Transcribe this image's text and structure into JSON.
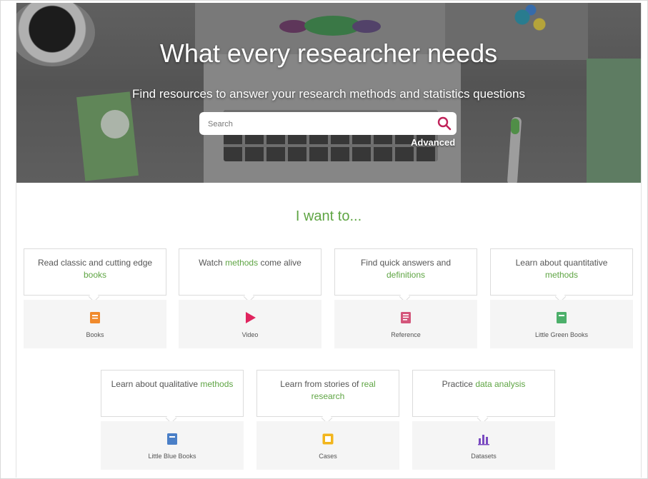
{
  "hero": {
    "title": "What every researcher needs",
    "subtitle": "Find resources to answer your research methods and statistics questions",
    "search_placeholder": "Search",
    "advanced_label": "Advanced"
  },
  "want_heading": "I want to...",
  "colors": {
    "accent_green": "#5fa544",
    "books_orange": "#f08a2c",
    "video_red": "#e0245e",
    "reference_pink": "#d3557a",
    "lgb_green": "#4caf6a",
    "lbb_blue": "#4a7fc7",
    "cases_yellow": "#f2b51c",
    "datasets_purple": "#7a4bc1"
  },
  "cards_row1": [
    {
      "pre": "Read classic and cutting edge ",
      "hl": "books",
      "post": "",
      "label": "Books",
      "icon": "book-icon"
    },
    {
      "pre": "Watch ",
      "hl": "methods",
      "post": " come alive",
      "label": "Video",
      "icon": "play-icon"
    },
    {
      "pre": "Find quick answers and ",
      "hl": "definitions",
      "post": "",
      "label": "Reference",
      "icon": "reference-icon"
    },
    {
      "pre": "Learn about quantitative ",
      "hl": "methods",
      "post": "",
      "label": "Little Green Books",
      "icon": "green-book-icon"
    }
  ],
  "cards_row2": [
    {
      "pre": "Learn about qualitative ",
      "hl": "methods",
      "post": "",
      "label": "Little Blue Books",
      "icon": "blue-book-icon"
    },
    {
      "pre": "Learn from stories of ",
      "hl": "real research",
      "post": "",
      "label": "Cases",
      "icon": "cases-icon"
    },
    {
      "pre": "Practice ",
      "hl": "data analysis",
      "post": "",
      "label": "Datasets",
      "icon": "bar-chart-icon"
    }
  ]
}
